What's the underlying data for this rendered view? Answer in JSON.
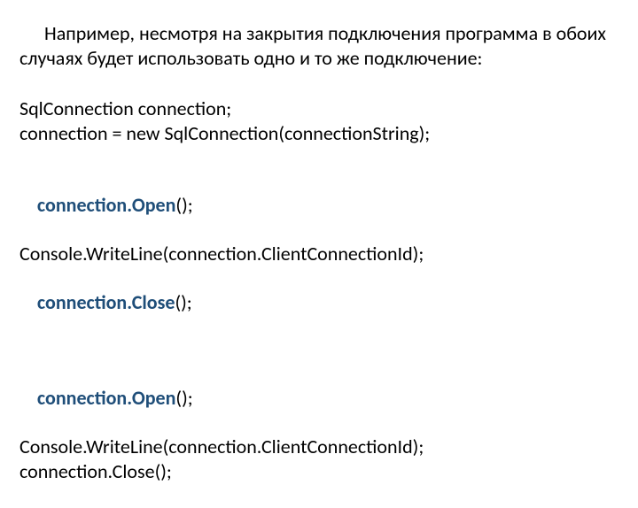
{
  "intro": {
    "line1": "Например, несмотря на закрытия подключения программа в обоих случаях будет использовать одно и то же подключение:"
  },
  "code": {
    "decl1": "SqlConnection connection;",
    "decl2": "connection = new SqlConnection(connectionString);",
    "open1_kw": "connection.Open",
    "open1_rest": "();",
    "write1": "Console.WriteLine(connection.ClientConnectionId);",
    "close1_kw": "connection.Close",
    "close1_rest": "();",
    "open2_kw": "connection.Open",
    "open2_rest": "();",
    "write2": "Console.WriteLine(connection.ClientConnectionId);",
    "close2": "connection.Close();"
  }
}
